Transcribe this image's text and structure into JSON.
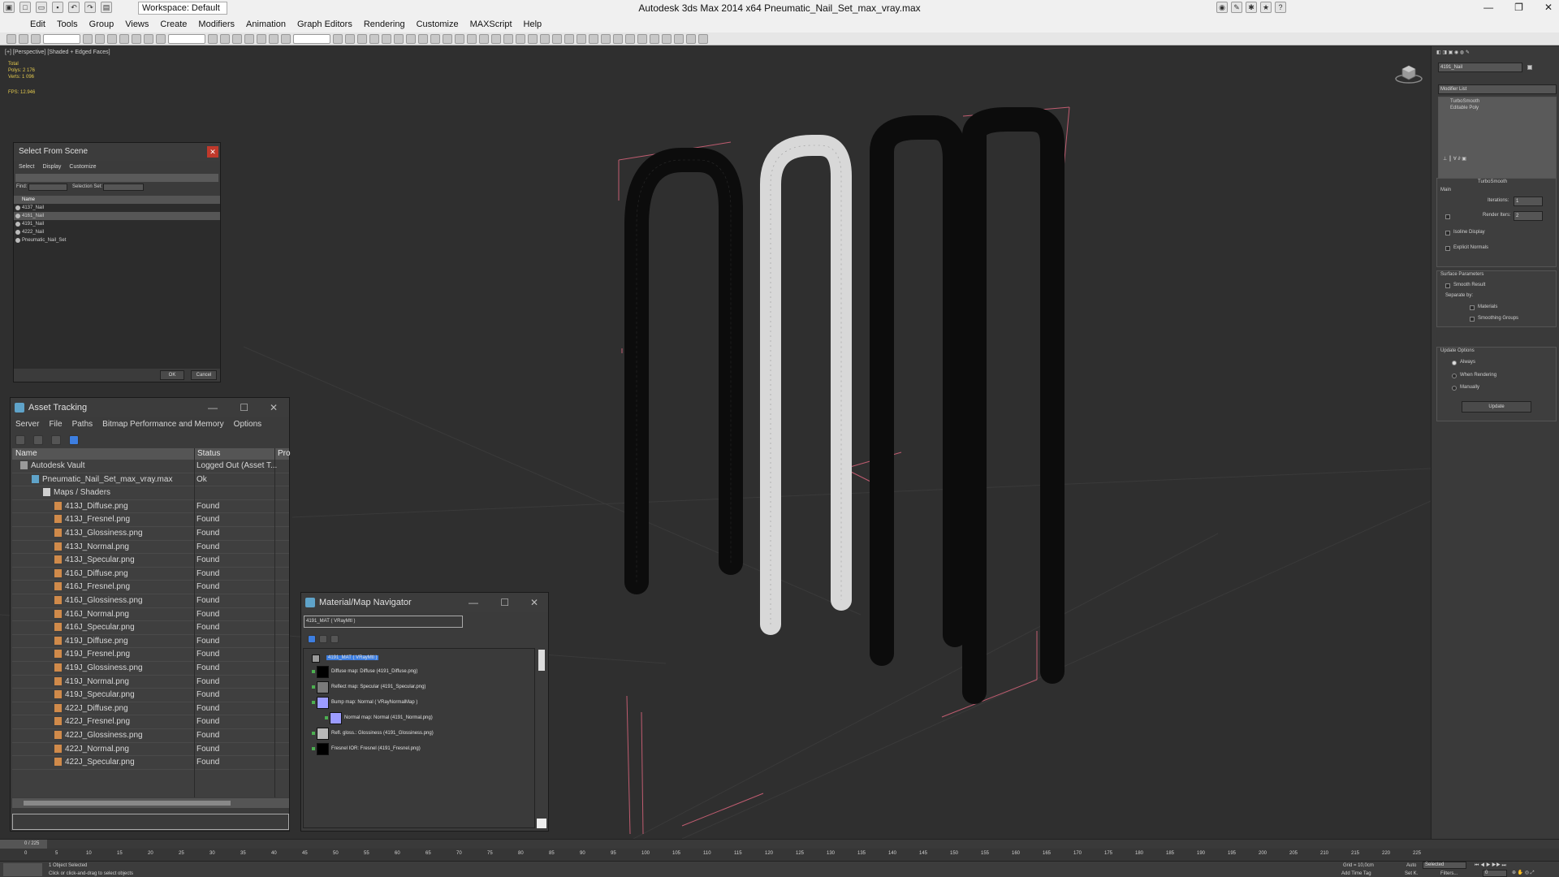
{
  "app": {
    "title": "Autodesk 3ds Max  2014 x64     Pneumatic_Nail_Set_max_vray.max",
    "workspace": "Workspace: Default"
  },
  "menu": [
    "Edit",
    "Tools",
    "Group",
    "Views",
    "Create",
    "Modifiers",
    "Animation",
    "Graph Editors",
    "Rendering",
    "Customize",
    "MAXScript",
    "Help"
  ],
  "toolbar": {
    "selection_filter": "All",
    "view": "View",
    "named_set": "Create Selection Se"
  },
  "viewport": {
    "label": "[+] [Perspective] [Shaded + Edged Faces]",
    "stats": [
      "Total",
      "Polys:  2 176",
      "Verts:  1 096"
    ],
    "fps": "FPS:     12.946"
  },
  "command_panel": {
    "object_name": "4191_Nail",
    "modifier_list": "Modifier List",
    "stack": [
      "TurboSmooth",
      "Editable Poly"
    ],
    "rollout_title": "TurboSmooth",
    "main_label": "Main",
    "iterations_label": "Iterations:",
    "iterations_value": "1",
    "render_iters_label": "Render Iters:",
    "render_iters_value": "2",
    "isoline": "Isoline Display",
    "explicit_normals": "Explicit Normals",
    "surface_params": "Surface Parameters",
    "smooth_result": "Smooth Result",
    "separate_by": "Separate by:",
    "materials": "Materials",
    "smoothing_groups": "Smoothing Groups",
    "update_options": "Update Options",
    "always": "Always",
    "when_rendering": "When Rendering",
    "manually": "Manually",
    "update_button": "Update"
  },
  "select_from_scene": {
    "title": "Select From Scene",
    "menu": [
      "Select",
      "Display",
      "Customize"
    ],
    "find_label": "Find:",
    "selection_set_label": "Selection Set:",
    "column": "Name",
    "rows": [
      "4137_Nail",
      "4161_Nail",
      "4191_Nail",
      "4222_Nail",
      "Pneumatic_Nail_Set"
    ],
    "ok": "OK",
    "cancel": "Cancel"
  },
  "asset_tracking": {
    "title": "Asset Tracking",
    "menu": [
      "Server",
      "File",
      "Paths",
      "Bitmap Performance and Memory",
      "Options"
    ],
    "columns": [
      "Name",
      "Status",
      "Pro"
    ],
    "rows": [
      {
        "name": "Autodesk Vault",
        "status": "Logged Out (Asset T...",
        "indent": 0,
        "kind": "vault"
      },
      {
        "name": "Pneumatic_Nail_Set_max_vray.max",
        "status": "Ok",
        "indent": 1,
        "kind": "max"
      },
      {
        "name": "Maps / Shaders",
        "status": "",
        "indent": 2,
        "kind": "folder"
      },
      {
        "name": "413J_Diffuse.png",
        "status": "Found",
        "indent": 3,
        "kind": "file"
      },
      {
        "name": "413J_Fresnel.png",
        "status": "Found",
        "indent": 3,
        "kind": "file"
      },
      {
        "name": "413J_Glossiness.png",
        "status": "Found",
        "indent": 3,
        "kind": "file"
      },
      {
        "name": "413J_Normal.png",
        "status": "Found",
        "indent": 3,
        "kind": "file"
      },
      {
        "name": "413J_Specular.png",
        "status": "Found",
        "indent": 3,
        "kind": "file"
      },
      {
        "name": "416J_Diffuse.png",
        "status": "Found",
        "indent": 3,
        "kind": "file"
      },
      {
        "name": "416J_Fresnel.png",
        "status": "Found",
        "indent": 3,
        "kind": "file"
      },
      {
        "name": "416J_Glossiness.png",
        "status": "Found",
        "indent": 3,
        "kind": "file"
      },
      {
        "name": "416J_Normal.png",
        "status": "Found",
        "indent": 3,
        "kind": "file"
      },
      {
        "name": "416J_Specular.png",
        "status": "Found",
        "indent": 3,
        "kind": "file"
      },
      {
        "name": "419J_Diffuse.png",
        "status": "Found",
        "indent": 3,
        "kind": "file"
      },
      {
        "name": "419J_Fresnel.png",
        "status": "Found",
        "indent": 3,
        "kind": "file"
      },
      {
        "name": "419J_Glossiness.png",
        "status": "Found",
        "indent": 3,
        "kind": "file"
      },
      {
        "name": "419J_Normal.png",
        "status": "Found",
        "indent": 3,
        "kind": "file"
      },
      {
        "name": "419J_Specular.png",
        "status": "Found",
        "indent": 3,
        "kind": "file"
      },
      {
        "name": "422J_Diffuse.png",
        "status": "Found",
        "indent": 3,
        "kind": "file"
      },
      {
        "name": "422J_Fresnel.png",
        "status": "Found",
        "indent": 3,
        "kind": "file"
      },
      {
        "name": "422J_Glossiness.png",
        "status": "Found",
        "indent": 3,
        "kind": "file"
      },
      {
        "name": "422J_Normal.png",
        "status": "Found",
        "indent": 3,
        "kind": "file"
      },
      {
        "name": "422J_Specular.png",
        "status": "Found",
        "indent": 3,
        "kind": "file"
      }
    ]
  },
  "material_navigator": {
    "title": "Material/Map Navigator",
    "field": "4191_MAT  ( VRayMtl )",
    "root": "4191_MAT  ( VRayMtl )",
    "items": [
      {
        "label": "Diffuse map: Diffuse (4191_Diffuse.png)",
        "color": "#000000",
        "indent": 0
      },
      {
        "label": "Reflect map: Specular (4191_Specular.png)",
        "color": "#7a7a7a",
        "indent": 0
      },
      {
        "label": "Bump map: Normal  ( VRayNormalMap )",
        "color": "#9c9cff",
        "indent": 0
      },
      {
        "label": "Normal map: Normal (4191_Normal.png)",
        "color": "#9c9cff",
        "indent": 1
      },
      {
        "label": "Refl. gloss.: Glossiness (4191_Glossiness.png)",
        "color": "#b8b8b8",
        "indent": 0
      },
      {
        "label": "Fresnel IOR: Fresnel (4191_Fresnel.png)",
        "color": "#000000",
        "indent": 0
      }
    ]
  },
  "time": {
    "frame": "0 / 225",
    "ticks": [
      "0",
      "5",
      "10",
      "15",
      "20",
      "25",
      "30",
      "35",
      "40",
      "45",
      "50",
      "55",
      "60",
      "65",
      "70",
      "75",
      "80",
      "85",
      "90",
      "95",
      "100",
      "105",
      "110",
      "115",
      "120",
      "125",
      "130",
      "135",
      "140",
      "145",
      "150",
      "155",
      "160",
      "165",
      "170",
      "175",
      "180",
      "185",
      "190",
      "195",
      "200",
      "205",
      "210",
      "215",
      "220",
      "225"
    ]
  },
  "status": {
    "selected": "1 Object Selected",
    "prompt": "Click or click-and-drag to select objects",
    "grid": "Grid = 10,0cm",
    "auto": "Auto",
    "set_key": "Set K.",
    "selected_dropdown": "Selected",
    "filters": "Filters...",
    "add_time_tag": "Add Time Tag",
    "frame_value": "0"
  },
  "colors": {
    "viewport_bg": "#2f2f2f",
    "selection_blue": "#3d7ee0",
    "bbox_pink": "#d0687a",
    "found": "#d8d8d8"
  }
}
